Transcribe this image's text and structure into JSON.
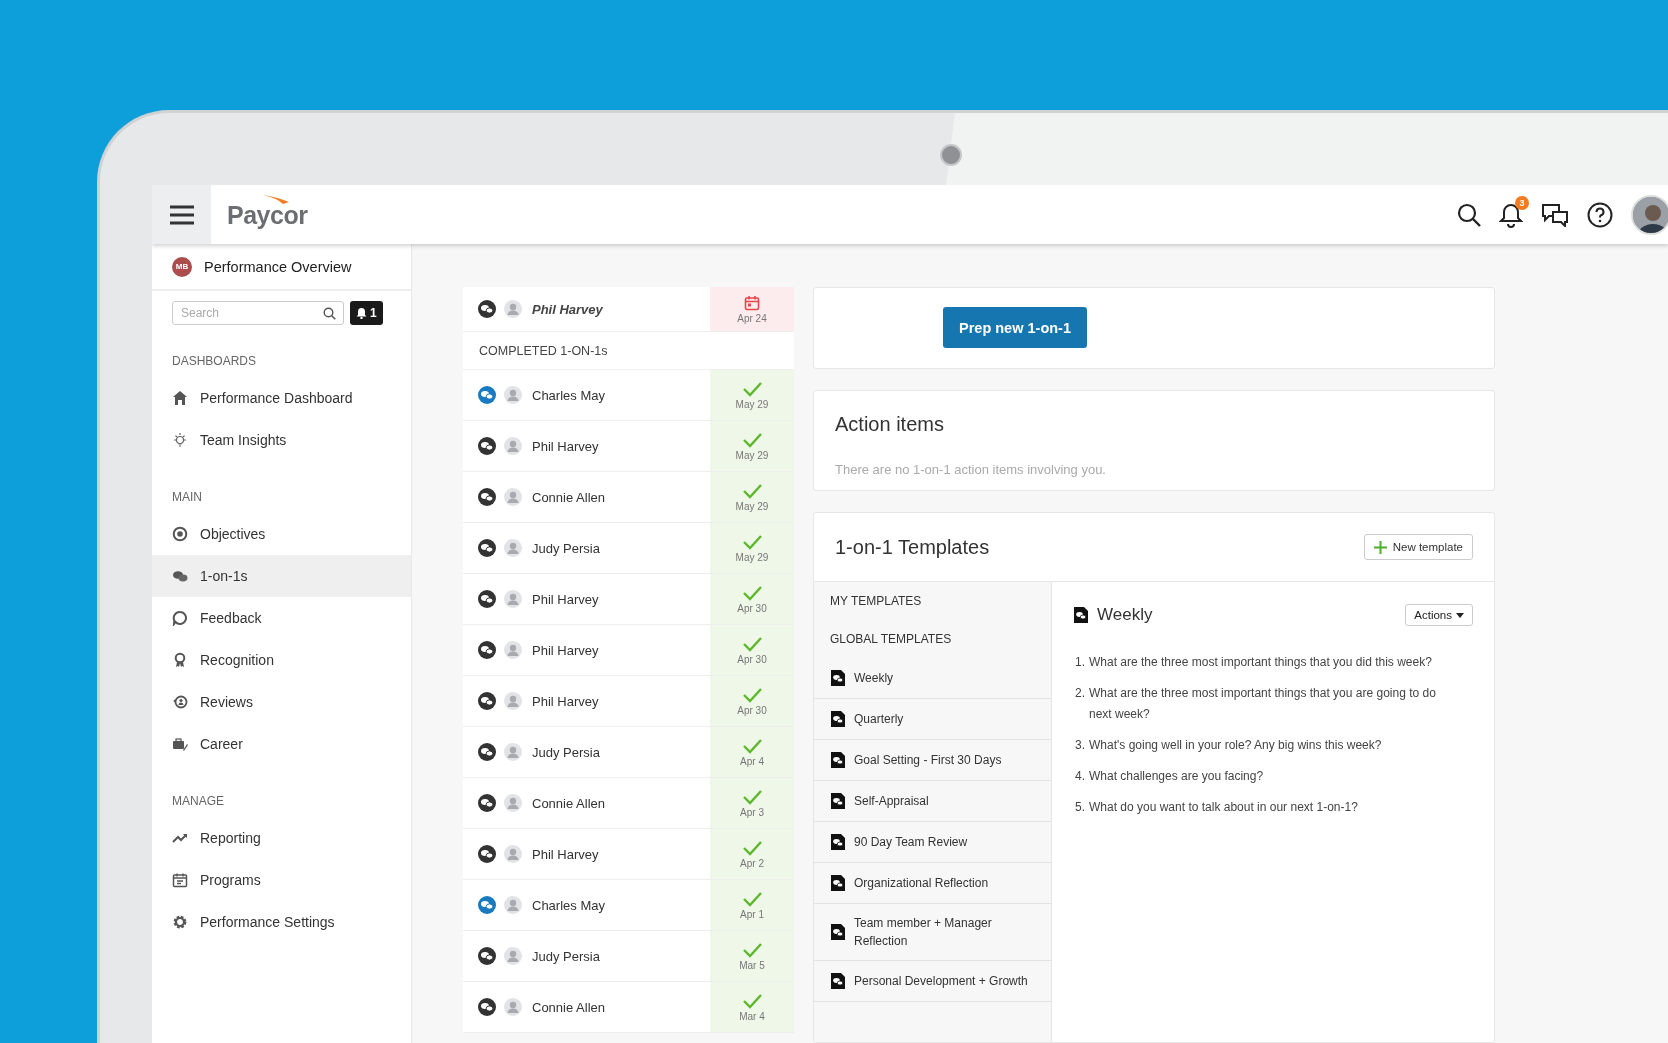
{
  "header": {
    "logo": "Paycor",
    "notification_count": "3"
  },
  "sidebar": {
    "profile": {
      "initials": "MB",
      "title": "Performance Overview"
    },
    "search": {
      "placeholder": "Search"
    },
    "alerts_count": "1",
    "sections": [
      {
        "heading": "DASHBOARDS",
        "items": [
          {
            "label": "Performance Dashboard",
            "selected": false
          },
          {
            "label": "Team Insights",
            "selected": false
          }
        ]
      },
      {
        "heading": "MAIN",
        "items": [
          {
            "label": "Objectives",
            "selected": false
          },
          {
            "label": "1-on-1s",
            "selected": true
          },
          {
            "label": "Feedback",
            "selected": false
          },
          {
            "label": "Recognition",
            "selected": false
          },
          {
            "label": "Reviews",
            "selected": false
          },
          {
            "label": "Career",
            "selected": false
          }
        ]
      },
      {
        "heading": "MANAGE",
        "items": [
          {
            "label": "Reporting",
            "selected": false
          },
          {
            "label": "Programs",
            "selected": false
          },
          {
            "label": "Performance Settings",
            "selected": false
          }
        ]
      }
    ]
  },
  "one_on_ones": {
    "upcoming": [
      {
        "name": "Phil Harvey",
        "date": "Apr 24",
        "color": "#333333"
      }
    ],
    "completed_heading": "COMPLETED 1-ON-1s",
    "completed": [
      {
        "name": "Charles May",
        "date": "May 29",
        "color": "#1a7ac0"
      },
      {
        "name": "Phil Harvey",
        "date": "May 29",
        "color": "#333333"
      },
      {
        "name": "Connie Allen",
        "date": "May 29",
        "color": "#333333"
      },
      {
        "name": "Judy Persia",
        "date": "May 29",
        "color": "#333333"
      },
      {
        "name": "Phil Harvey",
        "date": "Apr 30",
        "color": "#333333"
      },
      {
        "name": "Phil Harvey",
        "date": "Apr 30",
        "color": "#333333"
      },
      {
        "name": "Phil Harvey",
        "date": "Apr 30",
        "color": "#333333"
      },
      {
        "name": "Judy Persia",
        "date": "Apr 4",
        "color": "#333333"
      },
      {
        "name": "Connie Allen",
        "date": "Apr 3",
        "color": "#333333"
      },
      {
        "name": "Phil Harvey",
        "date": "Apr 2",
        "color": "#333333"
      },
      {
        "name": "Charles May",
        "date": "Apr 1",
        "color": "#1a7ac0"
      },
      {
        "name": "Judy Persia",
        "date": "Mar 5",
        "color": "#333333"
      },
      {
        "name": "Connie Allen",
        "date": "Mar 4",
        "color": "#333333"
      }
    ]
  },
  "prep_button": "Prep new 1-on-1",
  "action_items": {
    "title": "Action items",
    "empty_text": "There are no 1-on-1 action items involving you."
  },
  "templates": {
    "title": "1-on-1 Templates",
    "new_button": "New template",
    "my_heading": "MY TEMPLATES",
    "global_heading": "GLOBAL TEMPLATES",
    "items": [
      "Weekly",
      "Quarterly",
      "Goal Setting - First 30 Days",
      "Self-Appraisal",
      "90 Day Team Review",
      "Organizational Reflection",
      "Team member + Manager Reflection",
      "Personal Development + Growth"
    ],
    "detail": {
      "title": "Weekly",
      "actions": "Actions",
      "questions": [
        {
          "number": "1.",
          "text": "What are the three most important things that you did this week?"
        },
        {
          "number": "2.",
          "text": "What are the three most important things that you are going to do next week?"
        },
        {
          "number": "3.",
          "text": "What's going well in your role? Any big wins this week?"
        },
        {
          "number": "4.",
          "text": "What challenges are you facing?"
        },
        {
          "number": "5.",
          "text": "What do you want to talk about in our next 1-on-1?"
        }
      ]
    }
  }
}
